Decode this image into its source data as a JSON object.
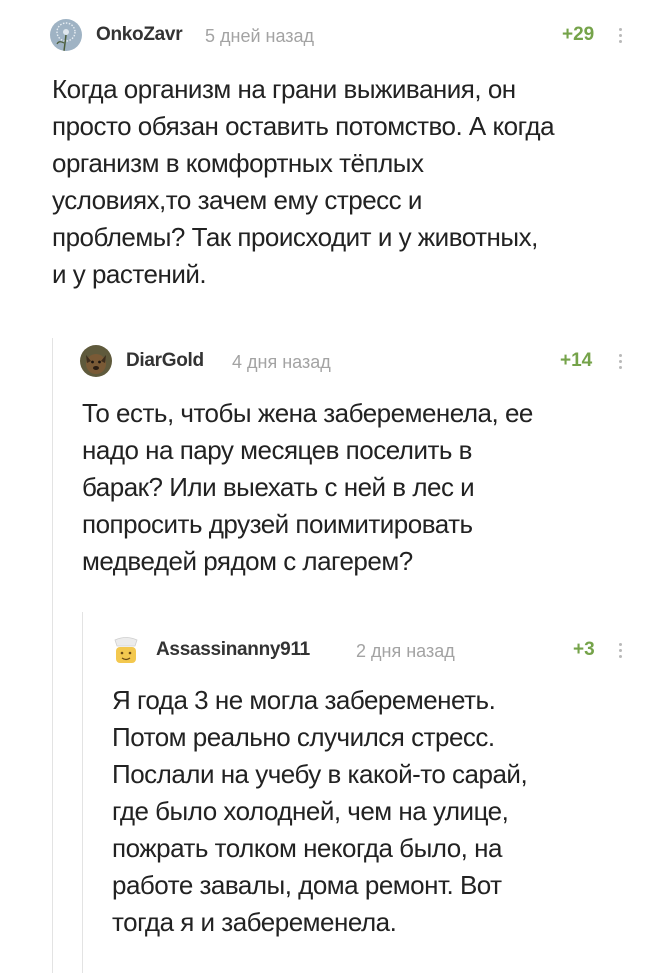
{
  "comments": [
    {
      "author": "OnkoZavr",
      "time": "5 дней назад",
      "rating": "+29",
      "avatar_icon": "dandelion-avatar-icon",
      "lines": [
        "Когда организм на грани выживания, он",
        "просто обязан оставить потомство. А когда",
        "организм в комфортных тёплых",
        "условиях,то зачем ему стресс и",
        "проблемы? Так происходит и у животных,",
        "и у растений."
      ]
    },
    {
      "author": "DiarGold",
      "time": "4 дня назад",
      "rating": "+14",
      "avatar_icon": "dog-avatar-icon",
      "lines": [
        "То есть, чтобы жена забеременела, ее",
        "надо на пару месяцев поселить в",
        "барак? Или выехать с ней в лес и",
        "попросить друзей поимитировать",
        "медведей рядом с лагерем?"
      ]
    },
    {
      "author": "Assassinanny911",
      "time": "2 дня назад",
      "rating": "+3",
      "avatar_icon": "cartoon-face-avatar-icon",
      "lines": [
        "Я года 3 не могла забеременеть.",
        "Потом реально случился стресс.",
        "Послали на учебу в какой-то сарай,",
        "где было холодней, чем на улице,",
        "пожрать толком некогда было, на",
        "работе завалы, дома ремонт. Вот",
        "тогда я и забеременела."
      ]
    }
  ],
  "colors": {
    "rating": "#75a34a",
    "time": "#a3a3a3",
    "author": "#333333",
    "thread_line": "#e3e3e3"
  }
}
